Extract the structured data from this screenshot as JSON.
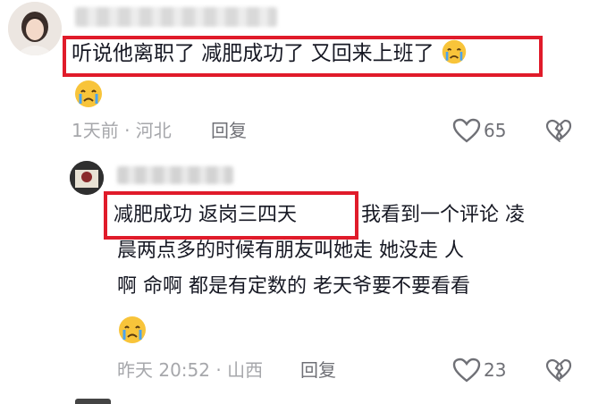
{
  "comment1": {
    "text_part1": "听说他离职了 减肥成功了 又回来上班了",
    "emoji": "crying-face-emoji",
    "meta": "1天前 · 河北",
    "reply_label": "回复",
    "likes": "65"
  },
  "comment2": {
    "highlight": "减肥成功 返岗三四天",
    "line1_rest": "我看到一个评论 凌",
    "line2": "晨两点多的时候有朋友叫她走 她没走 人",
    "line3": "啊 命啊 都是有定数的 老天爷要不要看看",
    "emoji": "crying-face-emoji",
    "meta": "昨天 20:52 · 山西",
    "reply_label": "回复",
    "likes": "23"
  },
  "colors": {
    "highlight_border": "#e01b2a",
    "meta_text": "#a6a7ab",
    "emoji_face": "#f8c43a",
    "tear": "#4aa3f0"
  }
}
